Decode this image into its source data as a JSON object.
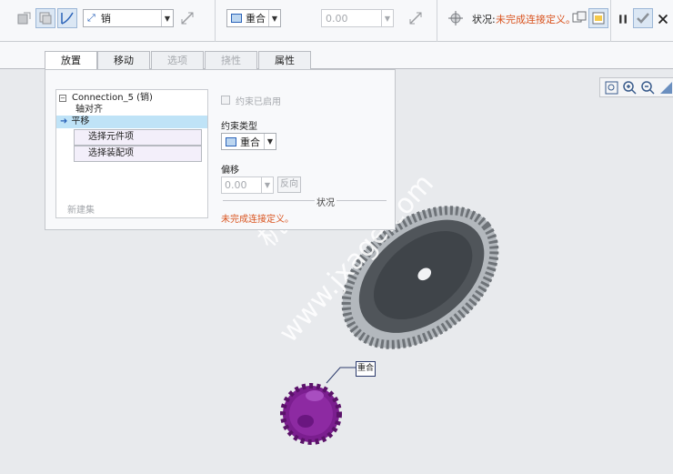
{
  "toolbar": {
    "connection_type": "销",
    "constraint_type": "重合",
    "offset_value": "0.00",
    "status_label": "状况:",
    "status_value": "未完成连接定义。"
  },
  "tabs": [
    {
      "label": "放置",
      "state": "active"
    },
    {
      "label": "移动",
      "state": "normal"
    },
    {
      "label": "选项",
      "state": "disabled"
    },
    {
      "label": "挠性",
      "state": "disabled"
    },
    {
      "label": "属性",
      "state": "normal"
    }
  ],
  "placement": {
    "tree": {
      "connection_name": "Connection_5 (销)",
      "item_axis": "轴对齐",
      "item_translate": "平移",
      "select_component_item": "选择元件项",
      "select_assembly_item": "选择装配项"
    },
    "new_set": "新建集",
    "constraint_enabled": "约束已启用",
    "constraint_type_label": "约束类型",
    "constraint_type_value": "重合",
    "offset_label": "偏移",
    "offset_value": "0.00",
    "flip_button": "反向",
    "status_title": "状况",
    "status_text": "未完成连接定义。"
  },
  "viewport": {
    "watermark_line1": "机械时代网",
    "watermark_line2": "www.jxage.com",
    "callout_label": "重合",
    "colors": {
      "large_gear": "#6f7378",
      "small_gear": "#7b1e8f"
    }
  }
}
